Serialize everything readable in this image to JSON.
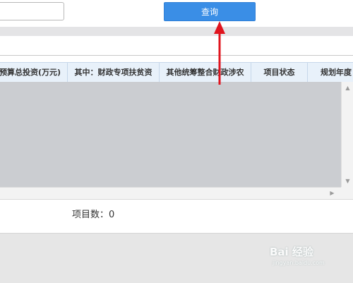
{
  "toolbar": {
    "query_label": "查询",
    "search_value": ""
  },
  "grid": {
    "headers": [
      "预算总投资(万元)",
      "其中：财政专项扶贫资",
      "其他统筹整合财政涉农",
      "项目状态",
      "规划年度"
    ]
  },
  "footer": {
    "project_count_text": "项目数：0"
  },
  "watermark": {
    "text": "Bai 经验",
    "sub": "jingyan.baidu.com"
  },
  "colors": {
    "accent": "#3a8ee6",
    "annotation": "#e0141e",
    "grid_body": "#cbcdd1",
    "header_bg": "#e8f1fa"
  }
}
